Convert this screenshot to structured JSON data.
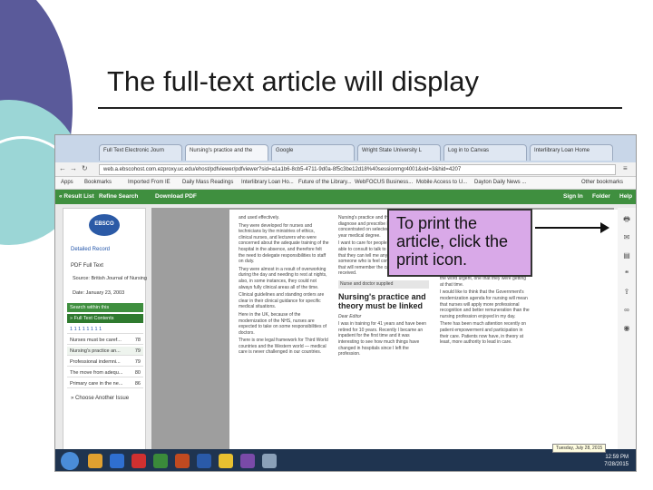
{
  "slide": {
    "title": "The full-text article will display"
  },
  "browser": {
    "tabs": [
      "Full Text Electronic Journ",
      "Nursing's practice and the",
      "Google",
      "Wright State University L",
      "Log in to Canvas",
      "Interlibrary Loan Home"
    ],
    "url": "web.a.ebscohost.com.ezproxy.uc.edu/ehost/pdfviewer/pdfviewer?sid=a1a1b6-8cb5-4711-9d0a-8f5c3be12d18%40sessionmgr4001&vid=3&hid=4207",
    "bookmarks": [
      "Apps",
      "Bookmarks",
      "Imported From IE",
      "Daily Mass Readings",
      "Interlibrary Loan Ho...",
      "Future of the Library...",
      "WebFOCUS Business...",
      "Mobile Access to U...",
      "Dayton Daily News ...",
      "Other bookmarks"
    ],
    "toolbar": {
      "result_list": "« Result List",
      "refine_search": "Refine Search",
      "download_pdf": "Download PDF",
      "sign_in": "Sign In",
      "folder": "Folder",
      "help": "Help"
    }
  },
  "left_panel": {
    "logo_text": "EBSCO",
    "detailed_record": "Detailed Record",
    "pdf_full_text": "PDF Full Text",
    "source_line": "Source: British Journal of Nursing",
    "date_line": "Date: January 23, 2003",
    "search_within": "Search within this",
    "pdf_contents": "» Full Text Contents",
    "pages_label": "1 1 1 1 1 1 1 1",
    "contents": [
      {
        "label": "Nurses must be caref...",
        "page": "78"
      },
      {
        "label": "Nursing's practice an...",
        "page": "79"
      },
      {
        "label": "Professional indemni...",
        "page": "79"
      },
      {
        "label": "The move from adequ...",
        "page": "80"
      },
      {
        "label": "Primary care in the ne...",
        "page": "86"
      }
    ],
    "choose_another": "» Choose Another Issue"
  },
  "pdf": {
    "col1": [
      "and used effectively.",
      "They were developed for nurses and technicians by the ministries of ethics, clinical nurses, and lecturers who were concerned about the adequate training of the hospital in the absence, and therefore felt the need to delegate responsibilities to staff on duty.",
      "They were almost in a result of overworking during the day and needing to rest at nights, also, in some instances, they could not always fully clinical areas all of the time.",
      "Clinical guidelines and standing orders are clear in their clinical guidance for specific medical situations.",
      "Here in the UK, because of the modernization of the NHS, nurses are expected to take on some responsibilities of doctors.",
      "There is one legal framework for Third World countries and the Western world — medical care is never challenged in our countries."
    ],
    "col2_heading": "Nursing's practice and theory must be linked",
    "col2_author": "Dear Editor",
    "col2": [
      "Nursing's practice and theory must to diagnose and prescribe I will have concentrated on selected undergoes a 8-year medical degree.",
      "I want to care for people. I patients to be able to consult to talk to me with ease and that they can tell me anything to be met as someone who is feel comfortable with and that will remember the care they have received.",
      "I was in training for 41 years and have been retired for 10 years. Recently I became an inpatient for the first time and it was interesting to see how much things have changed in hospitals since I left the profession."
    ],
    "col2_subhead": "Nurse and doctor supplied",
    "col3": [
      "relation of the fact that they were studying subjects which were not directly related to the word urgent, one that they were getting at that time.",
      "I would like to think that the Government's modernization agenda for nursing will mean that nurses will apply more professional recognition and better remuneration than the nursing profession enjoyed in my day.",
      "There has been much attention recently on patient empowerment and participation in their care. Patients now have, in theory at least, more authority to lead in care."
    ]
  },
  "callout": {
    "text": "To print the article, click the print icon."
  },
  "taskbar": {
    "time": "12:59 PM",
    "date": "7/28/2015",
    "tooltip": "Tuesday, July 28, 2015"
  }
}
